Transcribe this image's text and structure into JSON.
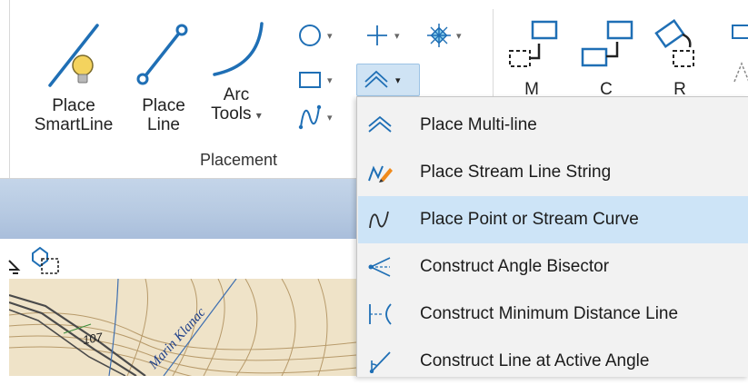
{
  "ribbon": {
    "buttons": [
      {
        "label_line1": "Place",
        "label_line2": "SmartLine"
      },
      {
        "label_line1": "Place",
        "label_line2": "Line"
      },
      {
        "label_line1": "Arc",
        "label_line2": "Tools",
        "caret": "▾"
      }
    ],
    "small_buttons": [
      "circle-icon",
      "crosshair-icon",
      "snowflake-icon",
      "rectangle-icon",
      "multiline-icon",
      "curve-icon"
    ],
    "dropdown_caret": "▾",
    "group_label": "Placement",
    "right_group_partial": [
      {
        "label_fragment": "M"
      },
      {
        "label_fragment": "C"
      },
      {
        "label_fragment": "R"
      }
    ]
  },
  "map": {
    "road_label": "107",
    "creek_label": "Marin Klanac"
  },
  "dropdown": {
    "items": [
      {
        "label": "Place Multi-line",
        "icon": "multiline-icon",
        "highlighted": false
      },
      {
        "label": "Place Stream Line String",
        "icon": "stream-line-string-icon",
        "highlighted": false
      },
      {
        "label": "Place Point or Stream Curve",
        "icon": "stream-curve-icon",
        "highlighted": true
      },
      {
        "label": "Construct Angle Bisector",
        "icon": "angle-bisector-icon",
        "highlighted": false
      },
      {
        "label": "Construct Minimum Distance Line",
        "icon": "minimum-distance-icon",
        "highlighted": false
      },
      {
        "label": "Construct Line at Active Angle",
        "icon": "active-angle-icon",
        "highlighted": false
      }
    ]
  },
  "colors": {
    "accent_blue": "#1f6fb5",
    "highlight": "#cde4f7",
    "menu_bg": "#f2f2f2",
    "pencil_orange": "#f08a1c",
    "bulb_yellow": "#f4d35e"
  }
}
